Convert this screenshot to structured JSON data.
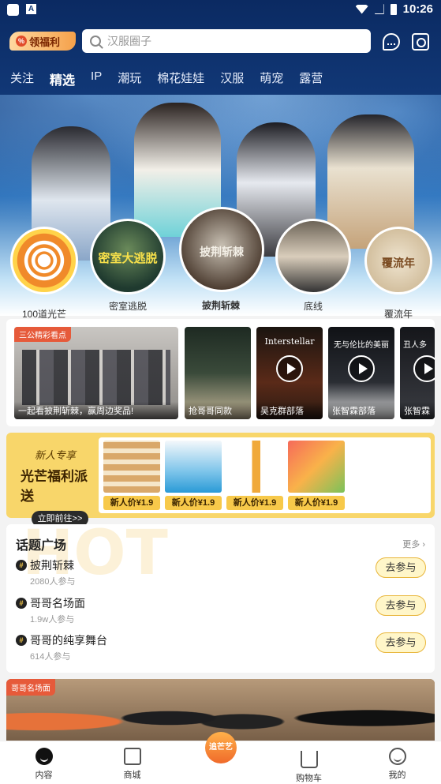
{
  "status_bar": {
    "time": "10:26"
  },
  "header": {
    "welfare_label": "领福利",
    "search_placeholder": "汉服圈子"
  },
  "tabs": [
    "关注",
    "精选",
    "IP",
    "潮玩",
    "棉花娃娃",
    "汉服",
    "萌宠",
    "露营"
  ],
  "active_tab": "精选",
  "circles": [
    {
      "label": "100道光芒"
    },
    {
      "label": "密室逃脱"
    },
    {
      "label": "披荆斩棘"
    },
    {
      "label": "底线"
    },
    {
      "label": "覆流年"
    }
  ],
  "circle_texts": {
    "c1": "密室大逃脱",
    "c2": "披荆斩棘",
    "c4": "覆流年"
  },
  "videos": {
    "tag": "三公精彩看点",
    "items": [
      {
        "caption": "一起看披荆斩棘，赢周边奖品!"
      },
      {
        "caption": "抢哥哥同款"
      },
      {
        "caption": "吴克群部落",
        "title": "Interstellar"
      },
      {
        "caption": "张智霖部落",
        "title": "无与伦比的美丽"
      },
      {
        "caption": "张智霖",
        "title": "丑人多"
      }
    ]
  },
  "promo": {
    "small": "新人专享",
    "big": "光芒福利派送",
    "go": "立即前往>>",
    "price_label": "新人价¥1.9",
    "goods": [
      "新人价¥1.9",
      "新人价¥1.9",
      "新人价¥1.9",
      "新人价¥1.9"
    ]
  },
  "topics": {
    "title": "话题广场",
    "watermark": "HOT",
    "more": "更多",
    "items": [
      {
        "name": "披荆斩棘",
        "count": "2080人参与",
        "button": "去参与"
      },
      {
        "name": "哥哥名场面",
        "count": "1.9w人参与",
        "button": "去参与"
      },
      {
        "name": "哥哥的纯享舞台",
        "count": "614人参与",
        "button": "去参与"
      }
    ]
  },
  "bottom_video": {
    "tag": "哥哥名场面"
  },
  "nav": {
    "items": [
      "内容",
      "商城",
      "",
      "购物车",
      "我的"
    ],
    "center": "追芒艺"
  },
  "colors": {
    "header_bg": "#0b2a62",
    "accent": "#f7c94a",
    "tag": "#e65a3a"
  }
}
